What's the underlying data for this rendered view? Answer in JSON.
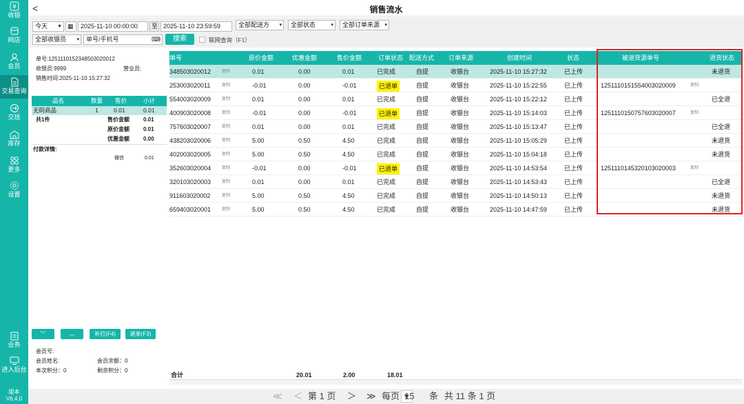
{
  "sidebar": {
    "items": [
      {
        "label": "收银"
      },
      {
        "label": "网店"
      },
      {
        "label": "会员"
      },
      {
        "label": "交易查询"
      },
      {
        "label": "交班"
      },
      {
        "label": "库存"
      },
      {
        "label": "更多"
      },
      {
        "label": "设置"
      },
      {
        "label": "业务"
      },
      {
        "label": "进入后台"
      }
    ],
    "version_label": "版本",
    "version": "V6.4.0"
  },
  "header": {
    "title": "销售流水"
  },
  "filters": {
    "period": "今天",
    "start": "2025-11-10 00:00:00",
    "to": "至",
    "end": "2025-11-10 23:59:59",
    "delivery": "全部配送方",
    "status": "全部状态",
    "source": "全部订单来源",
    "cashier": "全部收银员",
    "search_placeholder": "单号/手机号",
    "search_btn": "搜索",
    "online_query": "联网查询（F1）"
  },
  "receipt": {
    "order_no": "单号:1251110152348503020012",
    "cashier": "收银员:9999",
    "sales": "营业员:",
    "time": "销售时间:2025-11-10 15:27:32"
  },
  "items": {
    "headers": [
      "品名",
      "数量",
      "售价",
      "小计"
    ],
    "rows": [
      {
        "name": "无码商品",
        "qty": "1",
        "price": "0.01",
        "subtotal": "0.01"
      }
    ],
    "count": "共1件",
    "sale_amount_label": "售价金额",
    "sale_amount": "0.01",
    "orig_amount_label": "原价金额",
    "orig_amount": "0.01",
    "discount_label": "优惠金额",
    "discount": "0.00",
    "payment_label": "付款详情:",
    "pay_method": "微信",
    "pay_amount": "0.01"
  },
  "buttons": {
    "reprint": "补打(F4)",
    "refund": "退单(F3)"
  },
  "member": {
    "no": "会员号:",
    "name": "会员姓名:",
    "balance": "会员余额：0",
    "points": "本次积分：0",
    "remaining": "剩余积分：0"
  },
  "table": {
    "headers": [
      "单号",
      "原价金额",
      "优惠金额",
      "售价金额",
      "订单状态",
      "配送方式",
      "订单来源",
      "创建时间",
      "状态",
      "被退货源单号",
      "退货状态"
    ],
    "copy": "复制",
    "rows": [
      {
        "no": "348503020012",
        "orig": "0.01",
        "disc": "0.00",
        "sale": "0.01",
        "status": "已完成",
        "delivery": "自提",
        "source": "收银台",
        "time": "2025-11-10 15:27:32",
        "upload": "已上传",
        "ref": "",
        "ret": "未退货"
      },
      {
        "no": "253003020011",
        "orig": "-0.01",
        "disc": "0.00",
        "sale": "-0.01",
        "status": "已退单",
        "delivery": "自提",
        "source": "收银台",
        "time": "2025-11-10 15:22:55",
        "upload": "已上传",
        "ref": "1251110151554003020009",
        "ret": ""
      },
      {
        "no": "554003020009",
        "orig": "0.01",
        "disc": "0.00",
        "sale": "0.01",
        "status": "已完成",
        "delivery": "自提",
        "source": "收银台",
        "time": "2025-11-10 15:22:12",
        "upload": "已上传",
        "ref": "",
        "ret": "已全退"
      },
      {
        "no": "400903020008",
        "orig": "-0.01",
        "disc": "0.00",
        "sale": "-0.01",
        "status": "已退单",
        "delivery": "自提",
        "source": "收银台",
        "time": "2025-11-10 15:14:03",
        "upload": "已上传",
        "ref": "1251110150757603020007",
        "ret": ""
      },
      {
        "no": "757603020007",
        "orig": "0.01",
        "disc": "0.00",
        "sale": "0.01",
        "status": "已完成",
        "delivery": "自提",
        "source": "收银台",
        "time": "2025-11-10 15:13:47",
        "upload": "已上传",
        "ref": "",
        "ret": "已全退"
      },
      {
        "no": "438203020006",
        "orig": "5.00",
        "disc": "0.50",
        "sale": "4.50",
        "status": "已完成",
        "delivery": "自提",
        "source": "收银台",
        "time": "2025-11-10 15:05:29",
        "upload": "已上传",
        "ref": "",
        "ret": "未退货"
      },
      {
        "no": "402003020005",
        "orig": "5.00",
        "disc": "0.50",
        "sale": "4.50",
        "status": "已完成",
        "delivery": "自提",
        "source": "收银台",
        "time": "2025-11-10 15:04:18",
        "upload": "已上传",
        "ref": "",
        "ret": "未退货"
      },
      {
        "no": "352603020004",
        "orig": "-0.01",
        "disc": "0.00",
        "sale": "-0.01",
        "status": "已退单",
        "delivery": "自提",
        "source": "收银台",
        "time": "2025-11-10 14:53:54",
        "upload": "已上传",
        "ref": "1251110145320103020003",
        "ret": ""
      },
      {
        "no": "320103020003",
        "orig": "0.01",
        "disc": "0.00",
        "sale": "0.01",
        "status": "已完成",
        "delivery": "自提",
        "source": "收银台",
        "time": "2025-11-10 14:53:43",
        "upload": "已上传",
        "ref": "",
        "ret": "已全退"
      },
      {
        "no": "911603020002",
        "orig": "5.00",
        "disc": "0.50",
        "sale": "4.50",
        "status": "已完成",
        "delivery": "自提",
        "source": "收银台",
        "time": "2025-11-10 14:50:13",
        "upload": "已上传",
        "ref": "",
        "ret": "未退货"
      },
      {
        "no": "659403020001",
        "orig": "5.00",
        "disc": "0.50",
        "sale": "4.50",
        "status": "已完成",
        "delivery": "自提",
        "source": "收银台",
        "time": "2025-11-10 14:47:59",
        "upload": "已上传",
        "ref": "",
        "ret": "未退货"
      }
    ],
    "total_label": "合计",
    "total_disc": "20.01",
    "total_sale": "2.00",
    "total_final": "18.01"
  },
  "pager": {
    "first": "≪",
    "prev": "＜",
    "page_text": "第 1 页",
    "next": "＞",
    "last": "≫",
    "per_page_label": "每页",
    "per_page": "15",
    "unit": "条",
    "total_text": "共 11 条 1 页"
  },
  "colors": {
    "accent": "#16b5aa",
    "selected": "#bde8e4",
    "refund": "#fff200",
    "highlight_box": "#e02020"
  }
}
